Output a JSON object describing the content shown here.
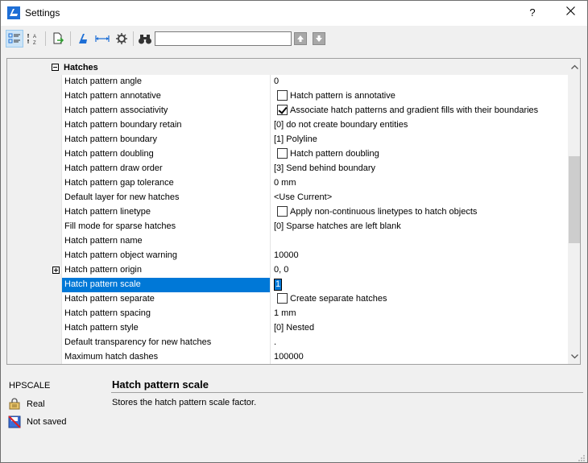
{
  "window": {
    "title": "Settings",
    "help_label": "?",
    "close_label": "✕"
  },
  "toolbar": {
    "search_value": "",
    "search_placeholder": ""
  },
  "section": {
    "title": "Hatches"
  },
  "rows": [
    {
      "name": "Hatch pattern angle",
      "value": "0"
    },
    {
      "name": "Hatch pattern annotative",
      "value": "Hatch pattern is annotative",
      "checkbox": false
    },
    {
      "name": "Hatch pattern associativity",
      "value": "Associate hatch patterns and gradient fills with their boundaries",
      "checkbox": true
    },
    {
      "name": "Hatch pattern boundary retain",
      "value": "[0] do not create boundary entities"
    },
    {
      "name": "Hatch pattern boundary",
      "value": "[1] Polyline"
    },
    {
      "name": "Hatch pattern doubling",
      "value": "Hatch pattern doubling",
      "checkbox": false
    },
    {
      "name": "Hatch pattern draw order",
      "value": "[3] Send behind boundary"
    },
    {
      "name": "Hatch pattern gap tolerance",
      "value": "0 mm"
    },
    {
      "name": "Default layer for new hatches",
      "value": "<Use Current>"
    },
    {
      "name": "Hatch pattern linetype",
      "value": "Apply non-continuous linetypes to hatch objects",
      "checkbox": false
    },
    {
      "name": "Fill mode for sparse hatches",
      "value": "[0] Sparse hatches are left blank"
    },
    {
      "name": "Hatch pattern name",
      "value": ""
    },
    {
      "name": "Hatch pattern object warning",
      "value": "10000"
    },
    {
      "name": "Hatch pattern origin",
      "value": "0, 0",
      "expandable": true
    },
    {
      "name": "Hatch pattern scale",
      "value": "1",
      "selected": true
    },
    {
      "name": "Hatch pattern separate",
      "value": "Create separate hatches",
      "checkbox": false
    },
    {
      "name": "Hatch pattern spacing",
      "value": "1 mm"
    },
    {
      "name": "Hatch pattern style",
      "value": "[0] Nested"
    },
    {
      "name": "Default transparency for new hatches",
      "value": "."
    },
    {
      "name": "Maximum hatch dashes",
      "value": "100000"
    }
  ],
  "info": {
    "variable": "HPSCALE",
    "type": "Real",
    "saved": "Not saved",
    "title": "Hatch pattern scale",
    "description": "Stores the hatch pattern scale factor."
  },
  "colors": {
    "selection": "#0078d7",
    "background": "#f0f0f0",
    "accent_icon": "#1e6fd6"
  }
}
